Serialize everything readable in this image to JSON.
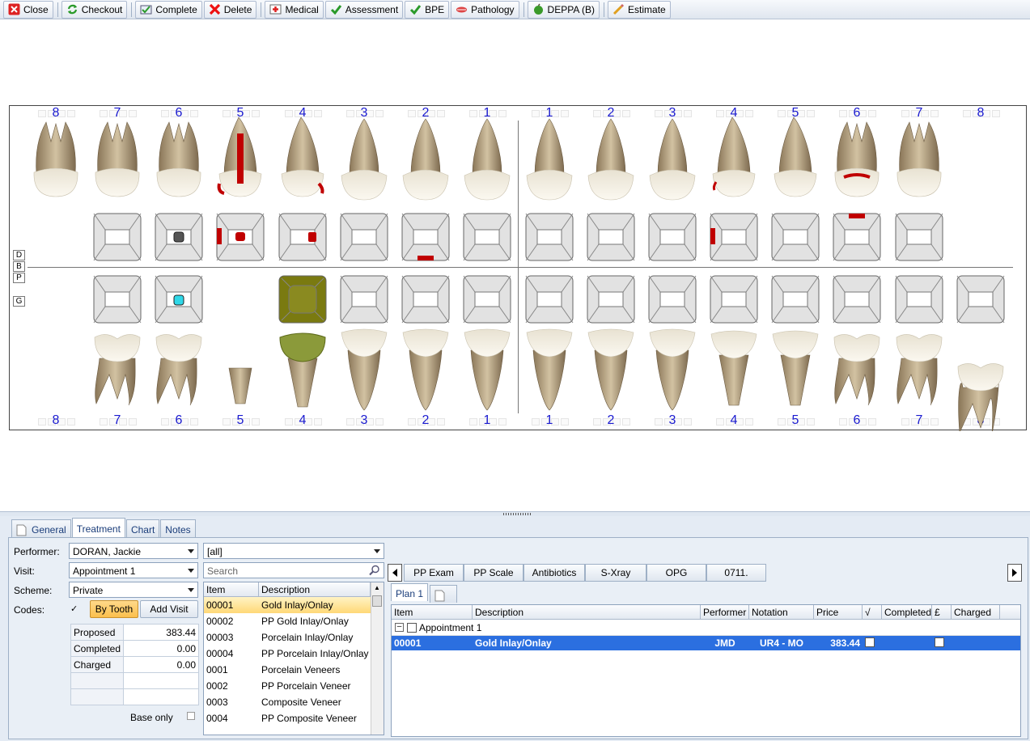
{
  "toolbar": {
    "buttons": [
      {
        "name": "close",
        "label": "Close",
        "icon": "close-icon"
      },
      {
        "name": "checkout",
        "label": "Checkout",
        "icon": "refresh-icon"
      },
      {
        "name": "complete",
        "label": "Complete",
        "icon": "complete-icon"
      },
      {
        "name": "delete",
        "label": "Delete",
        "icon": "red-x-icon"
      },
      {
        "name": "medical",
        "label": "Medical",
        "icon": "medical-icon"
      },
      {
        "name": "assessment",
        "label": "Assessment",
        "icon": "checkmark-icon"
      },
      {
        "name": "bpe",
        "label": "BPE",
        "icon": "checkmark-icon"
      },
      {
        "name": "pathology",
        "label": "Pathology",
        "icon": "lips-icon"
      },
      {
        "name": "deppa",
        "label": "DEPPA (B)",
        "icon": "apple-icon"
      },
      {
        "name": "estimate",
        "label": "Estimate",
        "icon": "pencil-icon"
      }
    ]
  },
  "chart": {
    "upper_numbers": [
      "8",
      "7",
      "6",
      "5",
      "4",
      "3",
      "2",
      "1",
      "1",
      "2",
      "3",
      "4",
      "5",
      "6",
      "7",
      "8"
    ],
    "lower_numbers": [
      "8",
      "7",
      "6",
      "5",
      "4",
      "3",
      "2",
      "1",
      "1",
      "2",
      "3",
      "4",
      "5",
      "6",
      "7",
      "8"
    ],
    "side_labels": [
      "D",
      "B",
      "P",
      "G"
    ]
  },
  "tabs": [
    {
      "label": "General",
      "active": false
    },
    {
      "label": "Treatment",
      "active": true
    },
    {
      "label": "Chart",
      "active": false
    },
    {
      "label": "Notes",
      "active": false
    }
  ],
  "form": {
    "performer_label": "Performer:",
    "performer_value": "DORAN, Jackie",
    "visit_label": "Visit:",
    "visit_value": "Appointment 1",
    "scheme_label": "Scheme:",
    "scheme_value": "Private",
    "codes_label": "Codes:",
    "codes_check": "✓",
    "by_tooth": "By Tooth",
    "add_visit": "Add Visit",
    "base_only": "Base only"
  },
  "summary": [
    {
      "label": "Proposed",
      "value": "383.44"
    },
    {
      "label": "Completed",
      "value": "0.00"
    },
    {
      "label": "Charged",
      "value": "0.00"
    }
  ],
  "filter": {
    "value": "[all]",
    "search_placeholder": "Search"
  },
  "item_list": {
    "headers": [
      "Item",
      "Description"
    ],
    "rows": [
      {
        "item": "00001",
        "desc": "Gold Inlay/Onlay"
      },
      {
        "item": "00002",
        "desc": "PP Gold Inlay/Onlay"
      },
      {
        "item": "00003",
        "desc": "Porcelain Inlay/Onlay"
      },
      {
        "item": "00004",
        "desc": "PP Porcelain Inlay/Onlay"
      },
      {
        "item": "0001",
        "desc": "Porcelain Veneers"
      },
      {
        "item": "0002",
        "desc": "PP Porcelain Veneer"
      },
      {
        "item": "0003",
        "desc": "Composite Veneer"
      },
      {
        "item": "0004",
        "desc": "PP Composite Veneer"
      }
    ]
  },
  "quick_buttons": [
    "PP Exam",
    "PP Scale",
    "Antibiotics",
    "S-Xray",
    "OPG",
    "0711."
  ],
  "plan_tab": "Plan 1",
  "plan": {
    "headers": [
      "Item",
      "Description",
      "Performer",
      "Notation",
      "Price",
      "√",
      "Completed",
      "£",
      "Charged"
    ],
    "group": "Appointment 1",
    "rows": [
      {
        "item": "00001",
        "desc": "Gold Inlay/Onlay",
        "performer": "JMD",
        "notation": "UR4 - MO",
        "price": "383.44"
      }
    ]
  },
  "colors": {
    "accent": "#2b6fe0",
    "restoration": "#cc0000",
    "gold": "#7a7a10",
    "number_blue": "#1a1ad0"
  }
}
